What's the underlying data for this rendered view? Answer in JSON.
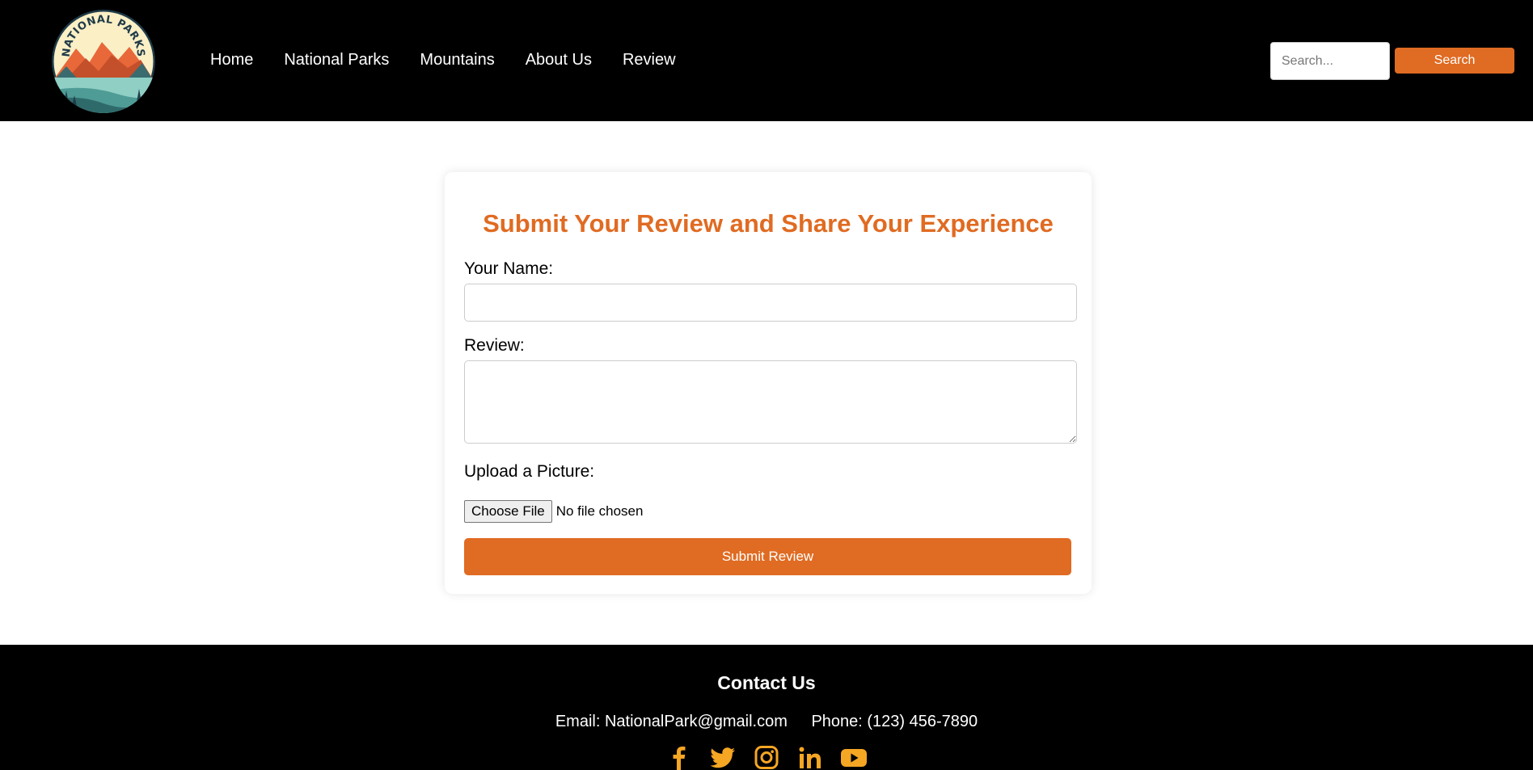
{
  "header": {
    "logo_text": "NATIONAL PARKS",
    "nav": [
      {
        "label": "Home"
      },
      {
        "label": "National Parks"
      },
      {
        "label": "Mountains"
      },
      {
        "label": "About Us"
      },
      {
        "label": "Review"
      }
    ],
    "search": {
      "placeholder": "Search...",
      "button_label": "Search"
    }
  },
  "form": {
    "title": "Submit Your Review and Share Your Experience",
    "name_label": "Your Name:",
    "name_value": "",
    "review_label": "Review:",
    "review_value": "",
    "upload_label": "Upload a Picture:",
    "choose_file_label": "Choose File",
    "file_status": "No file chosen",
    "submit_label": "Submit Review"
  },
  "footer": {
    "title": "Contact Us",
    "email": "Email: NationalPark@gmail.com",
    "phone": "Phone: (123) 456-7890",
    "social_icons": [
      "facebook-icon",
      "twitter-icon",
      "instagram-icon",
      "linkedin-icon",
      "youtube-icon"
    ]
  },
  "colors": {
    "accent": "#e06b22",
    "header_bg": "#000000",
    "footer_bg": "#000000",
    "social_icon": "#f5a623"
  }
}
